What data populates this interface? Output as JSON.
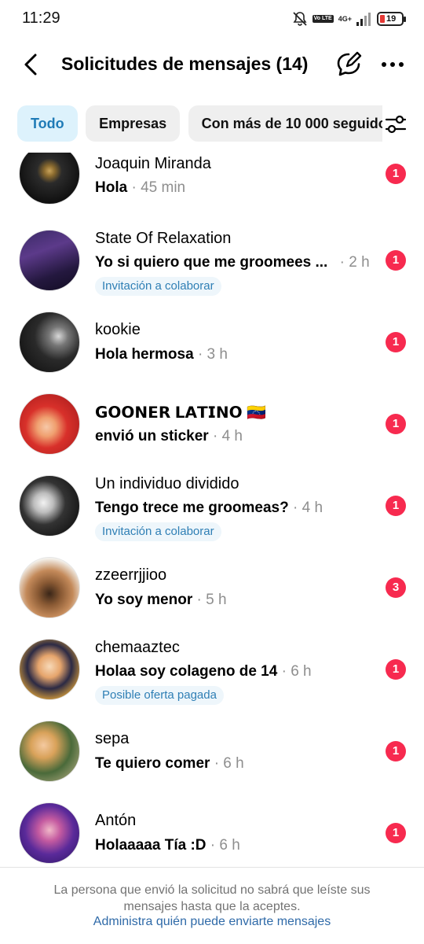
{
  "status_bar": {
    "time": "11:29",
    "volte": "Vo LTE",
    "network": "4G+",
    "battery": "19",
    "icons": [
      "bell-muted-icon",
      "signal-icon",
      "battery-icon"
    ]
  },
  "header": {
    "title": "Solicitudes de mensajes (14)",
    "icons": [
      "back-arrow-icon",
      "compose-message-icon",
      "more-options-icon"
    ]
  },
  "filters": [
    {
      "label": "Todo",
      "active": true
    },
    {
      "label": "Empresas",
      "active": false
    },
    {
      "label": "Con más de 10 000 seguidores",
      "active": false
    }
  ],
  "threads": [
    {
      "name": "Joaquin Miranda",
      "message": "Hola",
      "separator": "·",
      "time": "45 min",
      "tag": "",
      "badge": "1"
    },
    {
      "name": "State Of Relaxation",
      "message": "Yo si quiero que me groomees ...",
      "separator": "·",
      "time": "2 h",
      "tag": "Invitación a colaborar",
      "badge": "1"
    },
    {
      "name": "kookie",
      "message": "Hola hermosa",
      "separator": "·",
      "time": "3 h",
      "tag": "",
      "badge": "1"
    },
    {
      "name": "𝗚𝗢𝗢𝗡𝗘𝗥 𝗟𝗔𝗧𝗜𝗡𝗢 🇻🇪",
      "message": "envió un sticker",
      "separator": "·",
      "time": "4 h",
      "tag": "",
      "badge": "1"
    },
    {
      "name": "Un individuo dividido",
      "message": "Tengo trece me groomeas?",
      "separator": "·",
      "time": "4 h",
      "tag": "Invitación a colaborar",
      "badge": "1"
    },
    {
      "name": "zzeerrjjioo",
      "message": "Yo soy menor",
      "separator": "·",
      "time": "5 h",
      "tag": "",
      "badge": "3"
    },
    {
      "name": "chemaaztec",
      "message": "Holaa soy colageno de 14",
      "separator": "·",
      "time": "6 h",
      "tag": "Posible oferta pagada",
      "badge": "1"
    },
    {
      "name": "sepa",
      "message": "Te quiero comer",
      "separator": "·",
      "time": "6 h",
      "tag": "",
      "badge": "1"
    },
    {
      "name": "Antón",
      "message": "Holaaaaa Tía :D",
      "separator": "·",
      "time": "6 h",
      "tag": "",
      "badge": "1"
    }
  ],
  "footer": {
    "note": "La persona que envió la solicitud no sabrá que leíste sus mensajes hasta que la aceptes.",
    "link": "Administra quién puede enviarte mensajes"
  },
  "colors": {
    "accent_blue": "#1f7bb7",
    "badge_red": "#f72a4f",
    "active_chip_bg": "#ddf2fc"
  }
}
